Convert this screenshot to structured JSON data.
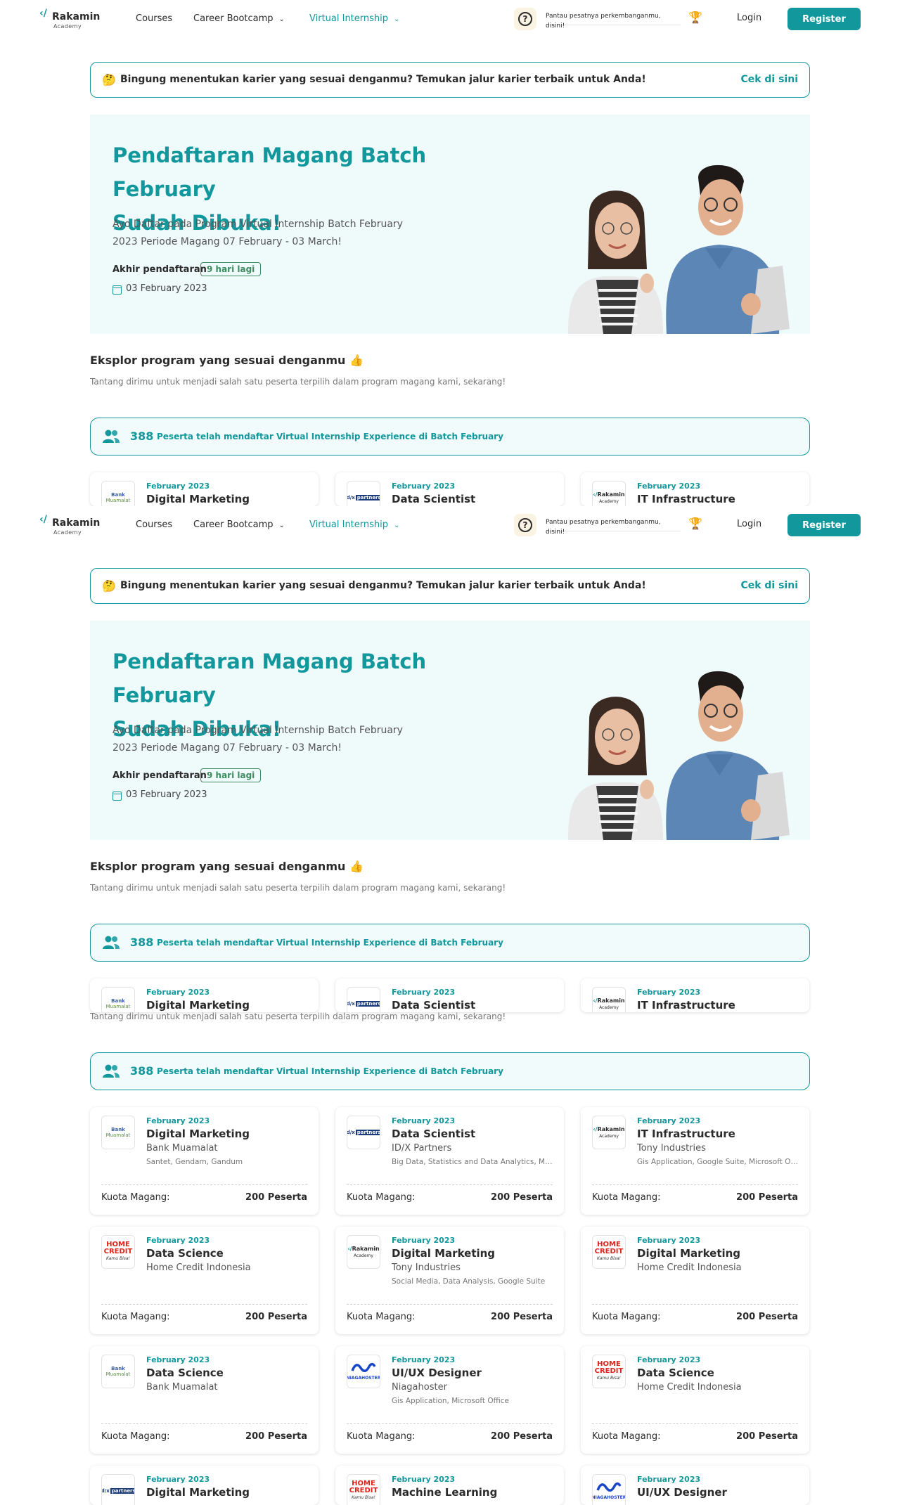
{
  "nav": {
    "logo_name": "Rakamin",
    "logo_sub": "Academy",
    "links": [
      "Courses",
      "Career Bootcamp",
      "Virtual Internship"
    ],
    "track_text": "Pantau pesatnya perkembanganmu, disini!",
    "login": "Login",
    "register": "Register"
  },
  "career_banner": {
    "text": "Bingung menentukan karier yang sesuai denganmu? Temukan jalur karier terbaik untuk Anda!",
    "link": "Cek di sini"
  },
  "hero": {
    "title_line1": "Pendaftaran Magang Batch February",
    "title_line2": "Sudah Dibuka!",
    "desc_line1": "Ayo Daftar pada Program Virtual Internship Batch February",
    "desc_line2": "2023 Periode Magang 07 February - 03 March!",
    "deadline_label": "Akhir pendaftaran",
    "days_left": "9 hari lagi",
    "deadline_date": "03 February 2023"
  },
  "explore": {
    "title": "Eksplor program yang sesuai denganmu",
    "subtitle": "Tantang dirimu untuk menjadi salah satu peserta terpilih dalam program magang kami, sekarang!"
  },
  "participants": {
    "count": "388",
    "label": "Peserta telah mendaftar Virtual Internship Experience di Batch February"
  },
  "quota_label": "Kuota Magang:",
  "cards": [
    {
      "period": "February 2023",
      "role": "Digital Marketing",
      "company": "Bank Muamalat",
      "skills": "Santet, Gendam, Gandum",
      "quota": "200 Peserta",
      "logo": "bm"
    },
    {
      "period": "February 2023",
      "role": "Data Scientist",
      "company": "ID/X Partners",
      "skills": "Big Data, Statistics and Data Analytics, Machine Learning",
      "quota": "200 Peserta",
      "logo": "idx"
    },
    {
      "period": "February 2023",
      "role": "IT Infrastructure",
      "company": "Tony Industries",
      "skills": "Gis Application, Google Suite, Microsoft Office",
      "quota": "200 Peserta",
      "logo": "rk"
    },
    {
      "period": "February 2023",
      "role": "Data Science",
      "company": "Home Credit Indonesia",
      "skills": "",
      "quota": "200 Peserta",
      "logo": "hc"
    },
    {
      "period": "February 2023",
      "role": "Digital Marketing",
      "company": "Tony Industries",
      "skills": "Social Media, Data Analysis, Google Suite",
      "quota": "200 Peserta",
      "logo": "rk"
    },
    {
      "period": "February 2023",
      "role": "Digital Marketing",
      "company": "Home Credit Indonesia",
      "skills": "",
      "quota": "200 Peserta",
      "logo": "hc"
    },
    {
      "period": "February 2023",
      "role": "Data Science",
      "company": "Bank Muamalat",
      "skills": "",
      "quota": "200 Peserta",
      "logo": "bm"
    },
    {
      "period": "February 2023",
      "role": "UI/UX Designer",
      "company": "Niagahoster",
      "skills": "Gis Application, Microsoft Office",
      "quota": "200 Peserta",
      "logo": "nh"
    },
    {
      "period": "February 2023",
      "role": "Data Science",
      "company": "Home Credit Indonesia",
      "skills": "",
      "quota": "200 Peserta",
      "logo": "hc"
    },
    {
      "period": "February 2023",
      "role": "Digital Marketing",
      "company": "",
      "skills": "",
      "quota": "",
      "logo": "idx"
    },
    {
      "period": "February 2023",
      "role": "Machine Learning",
      "company": "",
      "skills": "",
      "quota": "",
      "logo": "hc"
    },
    {
      "period": "February 2023",
      "role": "UI/UX Designer",
      "company": "",
      "skills": "",
      "quota": "",
      "logo": "nh"
    }
  ],
  "logos": {
    "bm": {
      "line1": "Bank",
      "line2": "Muamalat"
    },
    "idx": {
      "line1": "id/x",
      "line2": "partners"
    },
    "rk": {
      "line1": "Rakamin",
      "line2": "Academy"
    },
    "hc": {
      "line1": "HOME",
      "line2": "CREDIT",
      "line3": "Kamu Bisa!"
    },
    "nh": {
      "line1": "NIAGAHOSTER"
    }
  },
  "colors": {
    "accent": "#12989c",
    "hero_bg": "#effafa",
    "badge_green": "#3d8b5e",
    "home_credit_red": "#e0231c"
  },
  "icons": [
    "logo-mark-icon",
    "chevron-down-icon",
    "help-icon",
    "trophy-icon",
    "thinking-emoji-icon",
    "calendar-icon",
    "thumbs-up-icon",
    "people-icon"
  ]
}
